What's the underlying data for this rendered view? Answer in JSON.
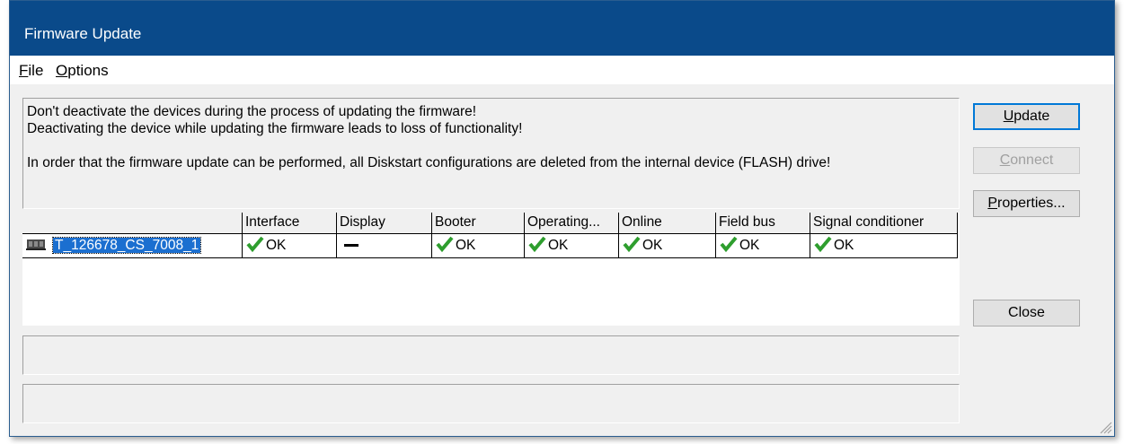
{
  "window": {
    "title": "Firmware Update"
  },
  "menu": {
    "file_prefix": "F",
    "file_rest": "ile",
    "options_prefix": "O",
    "options_rest": "ptions"
  },
  "info": {
    "line1": "Don't deactivate the devices during the process of updating the firmware!",
    "line2": "Deactivating the device while updating the firmware leads to loss of functionality!",
    "line3": "In order that the firmware update can be performed, all Diskstart configurations are deleted from the internal device (FLASH) drive!"
  },
  "table": {
    "headers": [
      "",
      "Interface",
      "Display",
      "Booter",
      "Operating...",
      "Online",
      "Field bus",
      "Signal conditioner"
    ],
    "rows": [
      {
        "device": "T_126678_CS_7008_1",
        "interface": "OK",
        "display": "",
        "booter": "OK",
        "operating": "OK",
        "online": "OK",
        "fieldbus": "OK",
        "signal": "OK"
      }
    ]
  },
  "buttons": {
    "update_prefix": "U",
    "update_rest": "pdate",
    "connect_prefix": "C",
    "connect_rest": "onnect",
    "properties_prefix": "P",
    "properties_rest": "roperties...",
    "close": "Close"
  },
  "colors": {
    "titlebar": "#0a4a8a",
    "selection": "#1b6fd0",
    "check": "#2e9e2e"
  },
  "icons": {
    "check": "check-icon",
    "device": "device-module-icon",
    "grip": "resize-grip-icon"
  }
}
